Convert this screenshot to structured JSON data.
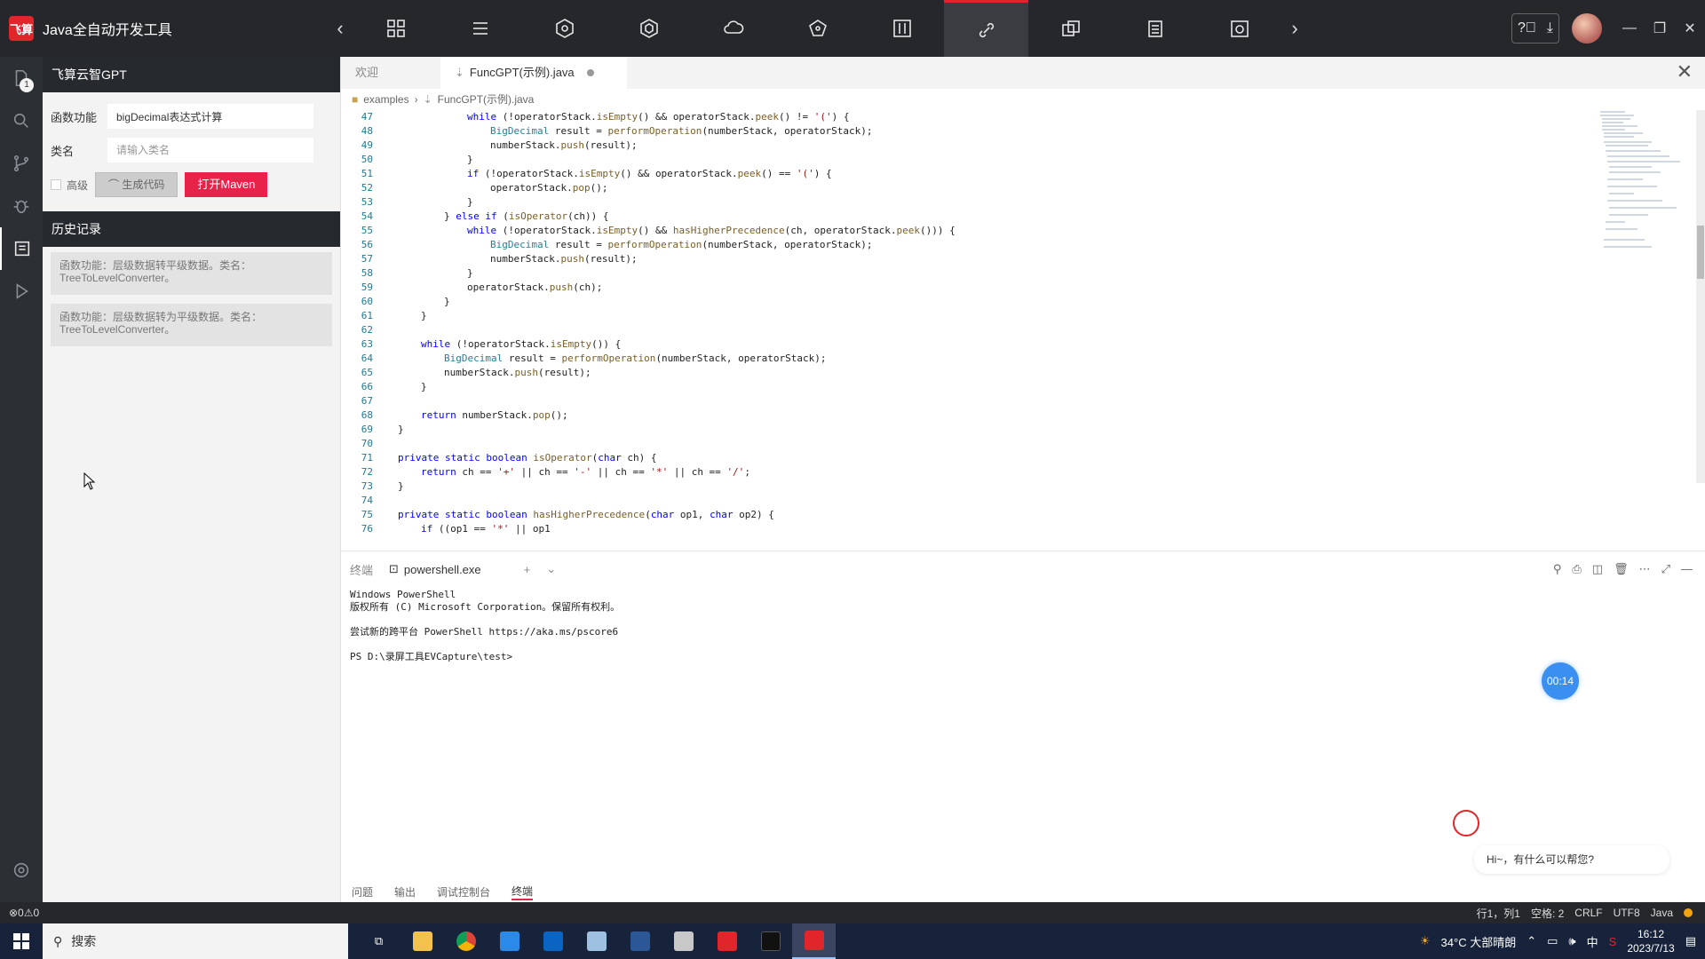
{
  "app": {
    "logo_text": "飞算",
    "title": "Java全自动开发工具"
  },
  "toolbar_tools": [
    "modules-icon",
    "list-icon",
    "hexagon-icon",
    "cube-icon",
    "jar-cloud-icon",
    "network-icon",
    "sliders-icon",
    "link-icon",
    "copy-icon",
    "clipboard-icon",
    "gear-box-icon"
  ],
  "activity_badge": "1",
  "sidebar": {
    "title": "飞算云智GPT",
    "function_label": "函数功能",
    "function_value": "bigDecimal表达式计算",
    "class_label": "类名",
    "class_placeholder": "请输入类名",
    "advanced_label": "高级",
    "generate_label": "生成代码",
    "maven_label": "打开Maven",
    "history_title": "历史记录",
    "history": [
      "函数功能：层级数据转平级数据。类名：TreeToLevelConverter。",
      "函数功能：层级数据转为平级数据。类名：TreeToLevelConverter。"
    ]
  },
  "editor": {
    "tabs": [
      "欢迎",
      "FuncGPT(示例).java"
    ],
    "breadcrumb": [
      "examples",
      "FuncGPT(示例).java"
    ],
    "code_lines": [
      {
        "n": "47",
        "indent": 3,
        "text": "while (!operatorStack.isEmpty() && operatorStack.peek() != '(') {"
      },
      {
        "n": "48",
        "indent": 4,
        "text": "BigDecimal result = performOperation(numberStack, operatorStack);"
      },
      {
        "n": "49",
        "indent": 4,
        "text": "numberStack.push(result);"
      },
      {
        "n": "50",
        "indent": 3,
        "text": "}"
      },
      {
        "n": "51",
        "indent": 3,
        "text": "if (!operatorStack.isEmpty() && operatorStack.peek() == '(') {"
      },
      {
        "n": "52",
        "indent": 4,
        "text": "operatorStack.pop();"
      },
      {
        "n": "53",
        "indent": 3,
        "text": "}"
      },
      {
        "n": "54",
        "indent": 2,
        "text": "} else if (isOperator(ch)) {"
      },
      {
        "n": "55",
        "indent": 3,
        "text": "while (!operatorStack.isEmpty() && hasHigherPrecedence(ch, operatorStack.peek())) {"
      },
      {
        "n": "56",
        "indent": 4,
        "text": "BigDecimal result = performOperation(numberStack, operatorStack);"
      },
      {
        "n": "57",
        "indent": 4,
        "text": "numberStack.push(result);"
      },
      {
        "n": "58",
        "indent": 3,
        "text": "}"
      },
      {
        "n": "59",
        "indent": 3,
        "text": "operatorStack.push(ch);"
      },
      {
        "n": "60",
        "indent": 2,
        "text": "}"
      },
      {
        "n": "61",
        "indent": 1,
        "text": "}"
      },
      {
        "n": "62",
        "indent": 0,
        "text": ""
      },
      {
        "n": "63",
        "indent": 1,
        "text": "while (!operatorStack.isEmpty()) {"
      },
      {
        "n": "64",
        "indent": 2,
        "text": "BigDecimal result = performOperation(numberStack, operatorStack);"
      },
      {
        "n": "65",
        "indent": 2,
        "text": "numberStack.push(result);"
      },
      {
        "n": "66",
        "indent": 1,
        "text": "}"
      },
      {
        "n": "67",
        "indent": 0,
        "text": ""
      },
      {
        "n": "68",
        "indent": 1,
        "text": "return numberStack.pop();"
      },
      {
        "n": "69",
        "indent": 0,
        "text": "}"
      },
      {
        "n": "70",
        "indent": 0,
        "text": ""
      },
      {
        "n": "71",
        "indent": 0,
        "text": "private static boolean isOperator(char ch) {"
      },
      {
        "n": "72",
        "indent": 1,
        "text": "return ch == '+' || ch == '-' || ch == '*' || ch == '/';"
      },
      {
        "n": "73",
        "indent": 0,
        "text": "}"
      },
      {
        "n": "74",
        "indent": 0,
        "text": ""
      },
      {
        "n": "75",
        "indent": 0,
        "text": "private static boolean hasHigherPrecedence(char op1, char op2) {"
      },
      {
        "n": "76",
        "indent": 1,
        "text": "if ((op1 == '*' || op1"
      }
    ]
  },
  "terminal": {
    "title": "终端",
    "tab": "powershell.exe",
    "lines": [
      "Windows PowerShell\n版权所有 (C) Microsoft Corporation。保留所有权利。",
      "尝试新的跨平台 PowerShell https://aka.ms/pscore6",
      "PS D:\\录屏工具EVCapture\\test>"
    ]
  },
  "timer": "00:14",
  "chat_prompt": "Hi~，有什么可以帮您?",
  "panel_tabs": [
    "问题",
    "输出",
    "调试控制台",
    "终端"
  ],
  "status": {
    "left": "⊗0⚠0",
    "position": "行1，列1",
    "spaces": "空格: 2",
    "eol": "CRLF",
    "encoding": "UTF8",
    "language": "Java"
  },
  "taskbar": {
    "search": "搜索",
    "weather": "34°C 大部晴朗",
    "ime": "中",
    "time": "16:12",
    "date": "2023/7/13"
  },
  "colors": {
    "accent": "#e8234a",
    "dark": "#25272b"
  }
}
